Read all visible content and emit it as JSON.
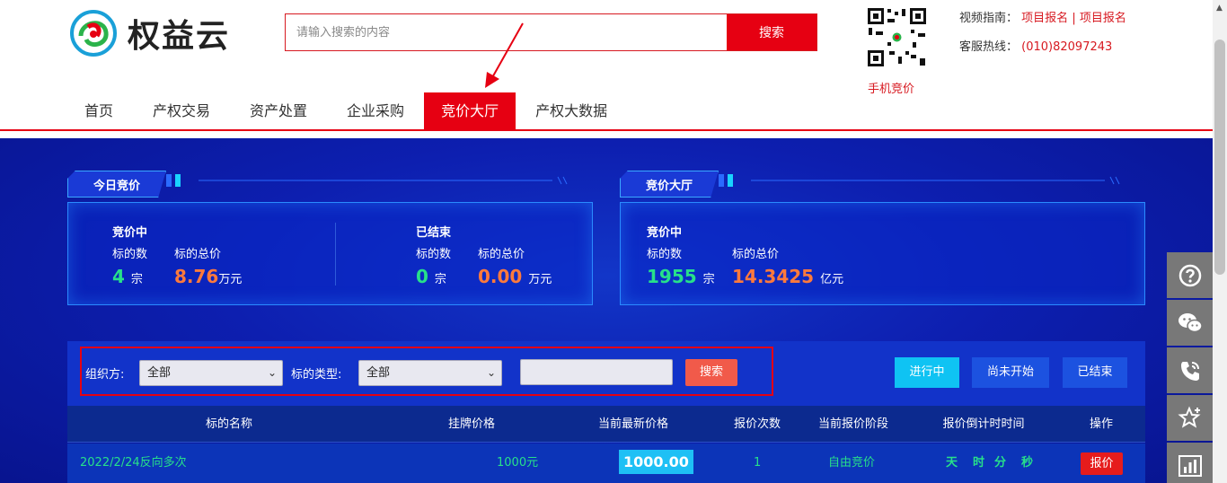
{
  "brand": {
    "name": "权益云"
  },
  "search": {
    "placeholder": "请输入搜索的内容",
    "button": "搜索"
  },
  "qr": {
    "label": "手机竞价"
  },
  "hint": {
    "label": "视频指南：",
    "link1": "项目报名",
    "sep": "|",
    "link2": "项目报名"
  },
  "hotline": {
    "label": "客服热线：",
    "number": "(010)82097243"
  },
  "nav": {
    "items": [
      "首页",
      "产权交易",
      "资产处置",
      "企业采购",
      "竞价大厅",
      "产权大数据"
    ],
    "active_index": 4
  },
  "today": {
    "tab": "今日竞价",
    "ongoing": {
      "title": "竞价中",
      "count_label": "标的数",
      "total_label": "标的总价",
      "count": "4",
      "count_unit": "宗",
      "total": "8.76",
      "total_unit": "万元"
    },
    "ended": {
      "title": "已结束",
      "count_label": "标的数",
      "total_label": "标的总价",
      "count": "0",
      "count_unit": "宗",
      "total": "0.00",
      "total_unit": "万元"
    }
  },
  "hall": {
    "tab": "竞价大厅",
    "ongoing": {
      "title": "竞价中",
      "count_label": "标的数",
      "total_label": "标的总价",
      "count": "1955",
      "count_unit": "宗",
      "total": "14.3425",
      "total_unit": "亿元"
    }
  },
  "filter": {
    "org_label": "组织方:",
    "org_value": "全部",
    "type_label": "标的类型:",
    "type_value": "全部",
    "keyword": "",
    "search_button": "搜索"
  },
  "status_tabs": [
    "进行中",
    "尚未开始",
    "已结束"
  ],
  "table": {
    "headers": [
      "标的名称",
      "挂牌价格",
      "当前最新价格",
      "报价次数",
      "当前报价阶段",
      "报价倒计时时间",
      "操作"
    ],
    "rows": [
      {
        "name": "2022/2/24反向多次",
        "list_price": "1000元",
        "current_price": "1000.00",
        "bid_count": "1",
        "stage": "自由竞价",
        "countdown": {
          "day": "天",
          "hour": "时",
          "minute": "分",
          "second": "秒"
        },
        "action": "报价"
      }
    ]
  },
  "colors": {
    "brand_red": "#e60012",
    "bg_blue": "#0b1ba8",
    "green": "#27e08a",
    "orange": "#ff7a3c",
    "cyan": "#1ec0f5"
  },
  "sidebar_icons": [
    "help-icon",
    "wechat-icon",
    "phone-icon",
    "star-icon",
    "chart-icon"
  ]
}
